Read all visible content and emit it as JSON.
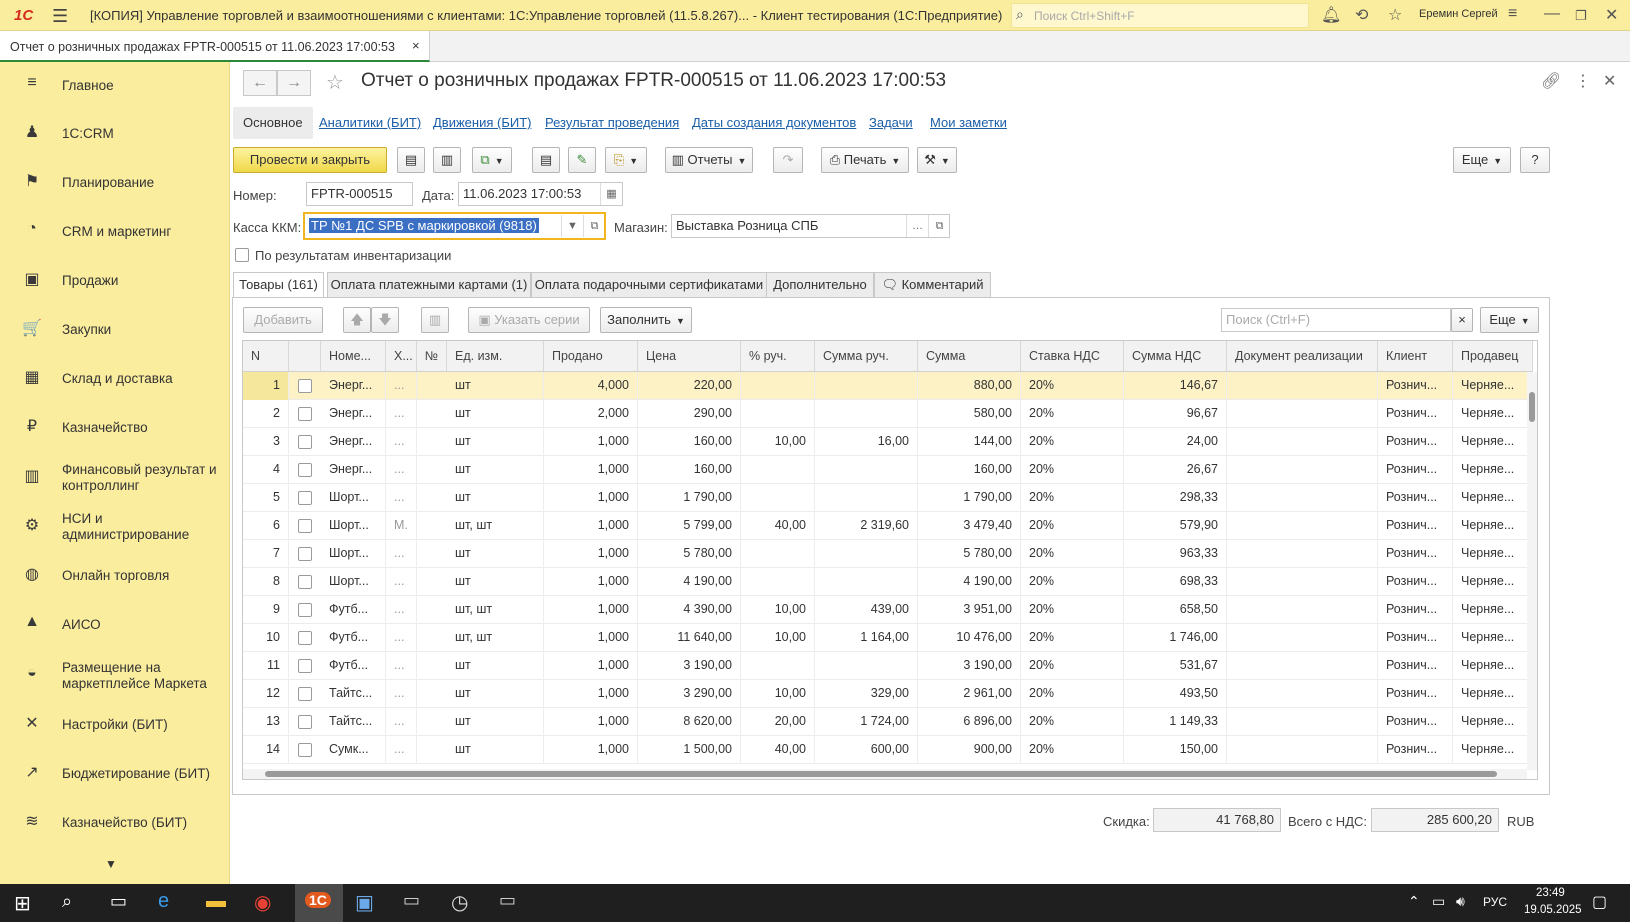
{
  "titlebar": {
    "logo": "1С",
    "title": "[КОПИЯ] Управление торговлей и взаимоотношениями с клиентами: 1С:Управление торговлей (11.5.8.267)...   - Клиент тестирования (1С:Предприятие)",
    "search_placeholder": "Поиск Ctrl+Shift+F",
    "user": "Еремин Сергей"
  },
  "tab": {
    "label": "Отчет о розничных продажах FPTR-000515 от 11.06.2023 17:00:53",
    "close": "×"
  },
  "sidebar": {
    "items": [
      {
        "label": "Главное",
        "icon": "≡"
      },
      {
        "label": "1С:CRM",
        "icon": "♟"
      },
      {
        "label": "Планирование",
        "icon": "⚑"
      },
      {
        "label": "CRM и маркетинг",
        "icon": "◔"
      },
      {
        "label": "Продажи",
        "icon": "▣"
      },
      {
        "label": "Закупки",
        "icon": "🛒"
      },
      {
        "label": "Склад и доставка",
        "icon": "▦"
      },
      {
        "label": "Казначейство",
        "icon": "₽"
      },
      {
        "label": "Финансовый результат и контроллинг",
        "icon": "▥"
      },
      {
        "label": "НСИ и администрирование",
        "icon": "⚙"
      },
      {
        "label": "Онлайн торговля",
        "icon": "◍"
      },
      {
        "label": "АИСО",
        "icon": "▲"
      },
      {
        "label": "Размещение на маркетплейсе Маркета",
        "icon": "◒"
      },
      {
        "label": "Настройки (БИТ)",
        "icon": "✕"
      },
      {
        "label": "Бюджетирование (БИТ)",
        "icon": "↗"
      },
      {
        "label": "Казначейство (БИТ)",
        "icon": "≋"
      }
    ],
    "more": "▼"
  },
  "doc": {
    "title": "Отчет о розничных продажах FPTR-000515 от 11.06.2023 17:00:53",
    "tabs": [
      "Основное",
      "Аналитики (БИТ)",
      "Движения (БИТ)",
      "Результат проведения",
      "Даты создания документов",
      "Задачи",
      "Мои заметки"
    ]
  },
  "toolbar": {
    "post_close": "Провести и закрыть",
    "reports": "Отчеты",
    "print": "Печать",
    "more": "Еще",
    "help": "?"
  },
  "form": {
    "number_label": "Номер:",
    "number": "FPTR-000515",
    "date_label": "Дата:",
    "date": "11.06.2023 17:00:53",
    "kkm_label": "Касса ККМ:",
    "kkm": "ТР №1 ДС SPB  с маркировкой (9818)",
    "shop_label": "Магазин:",
    "shop": "Выставка Розница СПБ",
    "inventory_label": "По результатам инвентаризации"
  },
  "inner_tabs": [
    "Товары (161)",
    "Оплата платежными картами (1)",
    "Оплата подарочными сертификатами",
    "Дополнительно",
    "Комментарий"
  ],
  "grid_toolbar": {
    "add": "Добавить",
    "series": "Указать серии",
    "fill": "Заполнить",
    "search_placeholder": "Поиск (Ctrl+F)",
    "clear": "×",
    "more": "Еще"
  },
  "grid": {
    "columns": [
      "N",
      "",
      "Номе...",
      "Х...",
      "№",
      "Ед. изм.",
      "Продано",
      "Цена",
      "% руч.",
      "Сумма руч.",
      "Сумма",
      "Ставка НДС",
      "Сумма НДС",
      "Документ реализации",
      "Клиент",
      "Продавец"
    ],
    "rows": [
      [
        "1",
        "Энерг...",
        "...",
        "шт",
        "4,000",
        "220,00",
        "",
        "",
        "880,00",
        "20%",
        "146,67",
        "",
        "Рознич...",
        "Черняе..."
      ],
      [
        "2",
        "Энерг...",
        "...",
        "шт",
        "2,000",
        "290,00",
        "",
        "",
        "580,00",
        "20%",
        "96,67",
        "",
        "Рознич...",
        "Черняе..."
      ],
      [
        "3",
        "Энерг...",
        "...",
        "шт",
        "1,000",
        "160,00",
        "10,00",
        "16,00",
        "144,00",
        "20%",
        "24,00",
        "",
        "Рознич...",
        "Черняе..."
      ],
      [
        "4",
        "Энерг...",
        "...",
        "шт",
        "1,000",
        "160,00",
        "",
        "",
        "160,00",
        "20%",
        "26,67",
        "",
        "Рознич...",
        "Черняе..."
      ],
      [
        "5",
        "Шорт...",
        "...",
        "шт",
        "1,000",
        "1 790,00",
        "",
        "",
        "1 790,00",
        "20%",
        "298,33",
        "",
        "Рознич...",
        "Черняе..."
      ],
      [
        "6",
        "Шорт...",
        "М.",
        "шт, шт",
        "1,000",
        "5 799,00",
        "40,00",
        "2 319,60",
        "3 479,40",
        "20%",
        "579,90",
        "",
        "Рознич...",
        "Черняе..."
      ],
      [
        "7",
        "Шорт...",
        "...",
        "шт",
        "1,000",
        "5 780,00",
        "",
        "",
        "5 780,00",
        "20%",
        "963,33",
        "",
        "Рознич...",
        "Черняе..."
      ],
      [
        "8",
        "Шорт...",
        "...",
        "шт",
        "1,000",
        "4 190,00",
        "",
        "",
        "4 190,00",
        "20%",
        "698,33",
        "",
        "Рознич...",
        "Черняе..."
      ],
      [
        "9",
        "Футб...",
        "...",
        "шт, шт",
        "1,000",
        "4 390,00",
        "10,00",
        "439,00",
        "3 951,00",
        "20%",
        "658,50",
        "",
        "Рознич...",
        "Черняе..."
      ],
      [
        "10",
        "Футб...",
        "...",
        "шт, шт",
        "1,000",
        "11 640,00",
        "10,00",
        "1 164,00",
        "10 476,00",
        "20%",
        "1 746,00",
        "",
        "Рознич...",
        "Черняе..."
      ],
      [
        "11",
        "Футб...",
        "...",
        "шт",
        "1,000",
        "3 190,00",
        "",
        "",
        "3 190,00",
        "20%",
        "531,67",
        "",
        "Рознич...",
        "Черняе..."
      ],
      [
        "12",
        "Тайтс...",
        "...",
        "шт",
        "1,000",
        "3 290,00",
        "10,00",
        "329,00",
        "2 961,00",
        "20%",
        "493,50",
        "",
        "Рознич...",
        "Черняе..."
      ],
      [
        "13",
        "Тайтс...",
        "...",
        "шт",
        "1,000",
        "8 620,00",
        "20,00",
        "1 724,00",
        "6 896,00",
        "20%",
        "1 149,33",
        "",
        "Рознич...",
        "Черняе..."
      ],
      [
        "14",
        "Сумк...",
        "...",
        "шт",
        "1,000",
        "1 500,00",
        "40,00",
        "600,00",
        "900,00",
        "20%",
        "150,00",
        "",
        "Рознич...",
        "Черняе..."
      ]
    ]
  },
  "footer": {
    "discount_label": "Скидка:",
    "discount": "41 768,80",
    "total_label": "Всего с НДС:",
    "total": "285 600,20",
    "currency": "RUB"
  },
  "taskbar": {
    "lang": "РУС",
    "time": "23:49",
    "date": "19.05.2025"
  }
}
